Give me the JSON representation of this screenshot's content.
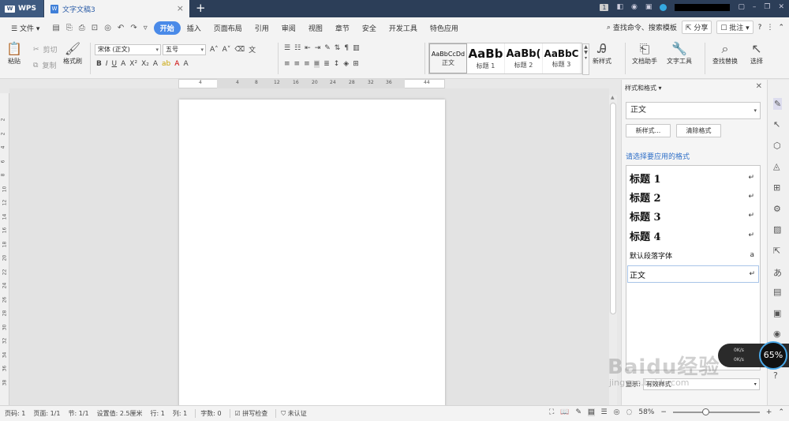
{
  "titlebar": {
    "app_name": "WPS",
    "app_logo": "W",
    "doc_icon": "W",
    "doc_tab": "文字文稿3",
    "close": "×",
    "new_tab": "+",
    "page_badge": "1"
  },
  "menubar": {
    "file": "文件",
    "items": [
      "开始",
      "插入",
      "页面布局",
      "引用",
      "审阅",
      "视图",
      "章节",
      "安全",
      "开发工具",
      "特色应用"
    ],
    "search": "查找命令、搜索模板",
    "share": "分享",
    "annotate": "批注",
    "help": "?"
  },
  "ribbon": {
    "paste": "粘贴",
    "cut": "剪切",
    "copy": "复制",
    "format_painter": "格式刷",
    "font_name": "宋体 (正文)",
    "font_size": "五号",
    "styles": [
      {
        "sample": "AaBbCcDd",
        "label": "正文"
      },
      {
        "sample": "AaBb",
        "label": "标题 1"
      },
      {
        "sample": "AaBb(",
        "label": "标题 2"
      },
      {
        "sample": "AaBbC",
        "label": "标题 3"
      }
    ],
    "new_style": "新样式",
    "doc_assistant": "文档助手",
    "text_tools": "文字工具",
    "find_replace": "查找替换",
    "select": "选择"
  },
  "ruler": {
    "h_numbers": [
      "4",
      "4",
      "8",
      "12",
      "16",
      "20",
      "24",
      "28",
      "32",
      "36",
      "44"
    ],
    "v_numbers": [
      "2",
      "2",
      "4",
      "6",
      "8",
      "10",
      "12",
      "14",
      "16",
      "18",
      "20",
      "22",
      "24",
      "26",
      "28",
      "30",
      "32",
      "34",
      "36",
      "38"
    ]
  },
  "pane": {
    "title": "样式和格式",
    "current_style": "正文",
    "new_style_btn": "新样式...",
    "clear_format_btn": "清除格式",
    "apply_label": "请选择要应用的格式",
    "items": [
      {
        "name": "标题  1",
        "mark": "↵"
      },
      {
        "name": "标题  2",
        "mark": "↵"
      },
      {
        "name": "标题  3",
        "mark": "↵"
      },
      {
        "name": "标题  4",
        "mark": "↵"
      },
      {
        "name": "默认段落字体",
        "mark": "a"
      },
      {
        "name": "正文",
        "mark": "↵"
      }
    ],
    "show_label": "显示:",
    "show_value": "有效样式"
  },
  "netwidget": {
    "up": "0K/s",
    "down": "0K/s",
    "percent": "65%"
  },
  "watermark": {
    "main": "Baidu经验",
    "sub": "jingyan.baidu.com"
  },
  "status": {
    "page_code": "页码: 1",
    "pages": "页面: 1/1",
    "section": "节: 1/1",
    "setting": "设置值: 2.5厘米",
    "row": "行: 1",
    "col": "列: 1",
    "words": "字数: 0",
    "spell": "拼写检查",
    "cert": "未认证",
    "zoom": "58%",
    "zoom_level": 0.37,
    "minus": "−",
    "plus": "+"
  }
}
